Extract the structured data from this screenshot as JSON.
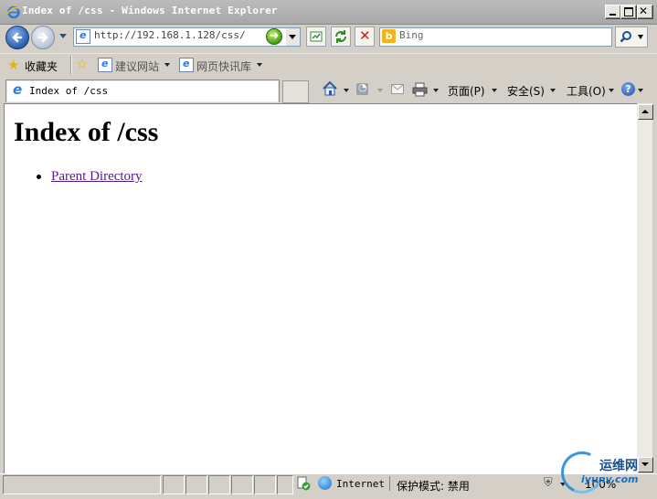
{
  "window": {
    "title": "Index of /css - Windows Internet Explorer",
    "controls": [
      "minimize",
      "maximize",
      "close"
    ]
  },
  "navigation": {
    "address": "http://192.168.1.128/css/",
    "search_provider": "Bing",
    "search_placeholder": "Bing"
  },
  "favorites_bar": {
    "favorites_label": "收藏夹",
    "items": [
      {
        "label": "建议网站",
        "has_dropdown": true
      },
      {
        "label": "网页快讯库",
        "has_dropdown": true
      }
    ]
  },
  "tabs": [
    {
      "label": "Index of /css",
      "active": true
    }
  ],
  "command_bar": {
    "page_menu": "页面(P)",
    "safety_menu": "安全(S)",
    "tools_menu": "工具(O)"
  },
  "page": {
    "heading": "Index of /css",
    "links": [
      {
        "label": "Parent Directory",
        "visited": true
      }
    ]
  },
  "status_bar": {
    "zone": "Internet",
    "protected_mode": "保护模式: 禁用",
    "zoom": "100%"
  },
  "watermark": {
    "title": "运维网",
    "url": "iyunv.com"
  },
  "colors": {
    "titlebar": "#a8a8a8",
    "chrome": "#d4d0c8",
    "link_visited": "#551a8b",
    "address_border": "#7f9db9"
  }
}
